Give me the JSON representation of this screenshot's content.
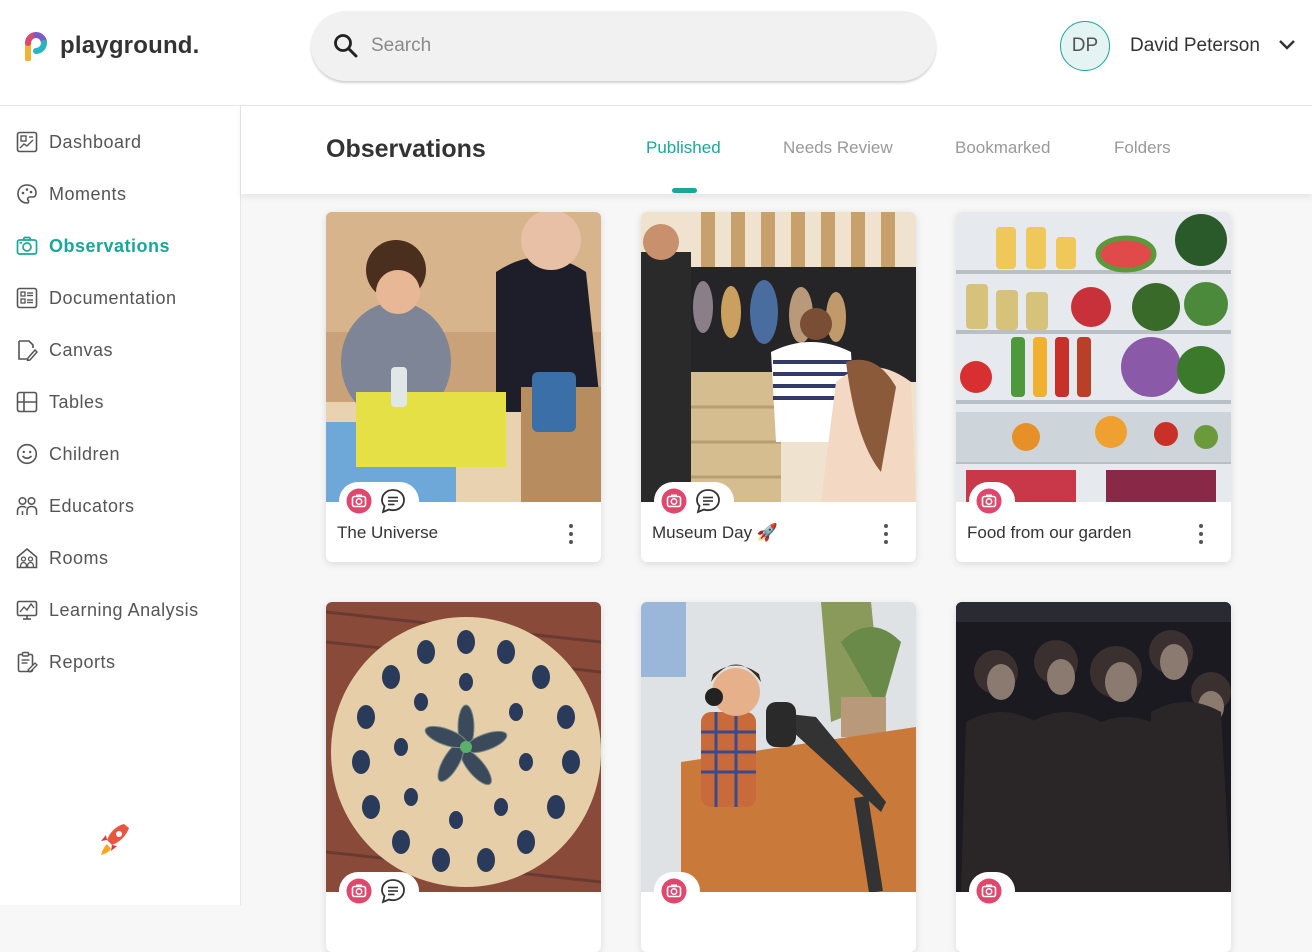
{
  "app": {
    "logo_text": "playground."
  },
  "search": {
    "placeholder": "Search"
  },
  "user": {
    "initials": "DP",
    "name": "David Peterson"
  },
  "sidebar": {
    "items": [
      {
        "label": "Dashboard",
        "icon": "dashboard-icon"
      },
      {
        "label": "Moments",
        "icon": "moments-icon"
      },
      {
        "label": "Observations",
        "icon": "camera-icon",
        "active": true
      },
      {
        "label": "Documentation",
        "icon": "documentation-icon"
      },
      {
        "label": "Canvas",
        "icon": "canvas-icon"
      },
      {
        "label": "Tables",
        "icon": "tables-icon"
      },
      {
        "label": "Children",
        "icon": "children-icon"
      },
      {
        "label": "Educators",
        "icon": "educators-icon"
      },
      {
        "label": "Rooms",
        "icon": "rooms-icon"
      },
      {
        "label": "Learning Analysis",
        "icon": "learning-analysis-icon"
      },
      {
        "label": "Reports",
        "icon": "reports-icon"
      }
    ]
  },
  "main": {
    "title": "Observations",
    "tabs": [
      {
        "label": "Published",
        "active": true
      },
      {
        "label": "Needs Review"
      },
      {
        "label": "Bookmarked"
      },
      {
        "label": "Folders"
      }
    ],
    "cards": [
      {
        "title": "The Universe",
        "badges": [
          "camera-icon",
          "comment-icon"
        ]
      },
      {
        "title": "Museum Day 🚀",
        "badges": [
          "camera-icon",
          "comment-icon"
        ]
      },
      {
        "title": "Food from our garden",
        "badges": [
          "camera-icon"
        ]
      },
      {
        "title": "",
        "badges": [
          "camera-icon",
          "comment-icon"
        ]
      },
      {
        "title": "",
        "badges": [
          "camera-icon"
        ]
      },
      {
        "title": "",
        "badges": [
          "camera-icon"
        ]
      }
    ]
  },
  "colors": {
    "accent": "#1aa79b",
    "badge": "#e0476c"
  }
}
